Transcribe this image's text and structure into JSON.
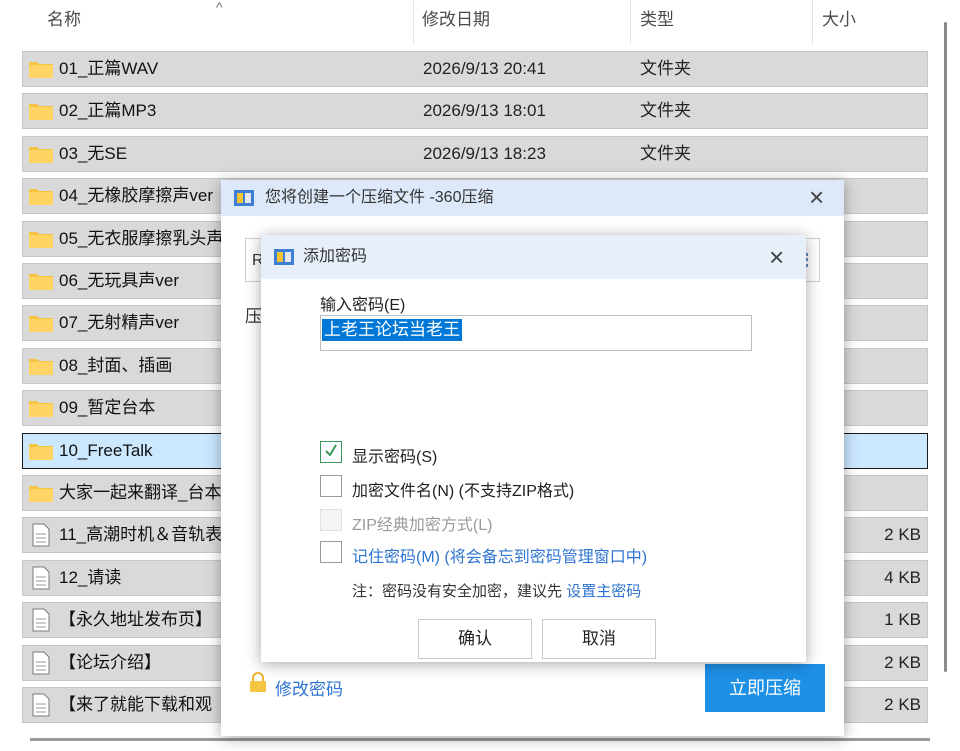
{
  "explorer": {
    "columns": {
      "name": "名称",
      "date": "修改日期",
      "type": "类型",
      "size": "大小"
    },
    "rows": [
      {
        "name": "01_正篇WAV",
        "date": "2026/9/13 20:41",
        "type": "文件夹",
        "size": "",
        "kind": "folder"
      },
      {
        "name": "02_正篇MP3",
        "date": "2026/9/13 18:01",
        "type": "文件夹",
        "size": "",
        "kind": "folder"
      },
      {
        "name": "03_无SE",
        "date": "2026/9/13 18:23",
        "type": "文件夹",
        "size": "",
        "kind": "folder"
      },
      {
        "name": "04_无橡胶摩擦声ver",
        "date": "",
        "type": "",
        "size": "",
        "kind": "folder"
      },
      {
        "name": "05_无衣服摩擦乳头声",
        "date": "",
        "type": "",
        "size": "",
        "kind": "folder"
      },
      {
        "name": "06_无玩具声ver",
        "date": "",
        "type": "",
        "size": "",
        "kind": "folder"
      },
      {
        "name": "07_无射精声ver",
        "date": "",
        "type": "",
        "size": "",
        "kind": "folder"
      },
      {
        "name": "08_封面、插画",
        "date": "",
        "type": "",
        "size": "",
        "kind": "folder"
      },
      {
        "name": "09_暂定台本",
        "date": "",
        "type": "",
        "size": "",
        "kind": "folder"
      },
      {
        "name": "10_FreeTalk",
        "date": "",
        "type": "",
        "size": "",
        "kind": "folder",
        "selected": true
      },
      {
        "name": "大家一起来翻译_台本",
        "date": "",
        "type": "",
        "size": "",
        "kind": "folder"
      },
      {
        "name": "11_高潮时机＆音轨表",
        "date": "",
        "type": "",
        "size": "2 KB",
        "kind": "file"
      },
      {
        "name": "12_请读",
        "date": "",
        "type": "",
        "size": "4 KB",
        "kind": "file"
      },
      {
        "name": "【永久地址发布页】",
        "date": "",
        "type": "",
        "size": "1 KB",
        "kind": "file"
      },
      {
        "name": "【论坛介绍】",
        "date": "",
        "type": "",
        "size": "2 KB",
        "kind": "file"
      },
      {
        "name": "【来了就能下载和观",
        "date": "",
        "type": "",
        "size": "2 KB",
        "kind": "file"
      }
    ]
  },
  "compress_dialog": {
    "title": "您将创建一个压缩文件 -360压缩",
    "path_prefix": "R",
    "label_prefix": "压",
    "modify_password": "修改密码",
    "compress_now": "立即压缩"
  },
  "password_dialog": {
    "title": "添加密码",
    "input_label": "输入密码(E)",
    "password_value": "上老王论坛当老王",
    "show_password": {
      "label": "显示密码(S)",
      "checked": true
    },
    "encrypt_filenames": {
      "label": "加密文件名(N) (不支持ZIP格式)",
      "checked": false
    },
    "zip_classic": {
      "label": "ZIP经典加密方式(L)",
      "checked": false,
      "disabled": true
    },
    "remember_password": {
      "label": "记住密码(M) (将会备忘到密码管理窗口中)",
      "checked": false
    },
    "note_text": "注：密码没有安全加密，建议先",
    "note_link": "设置主密码",
    "ok_button": "确认",
    "cancel_button": "取消"
  },
  "colors": {
    "accent": "#1e90e6",
    "link": "#2f74d0",
    "selection": "#0078d7",
    "folder": "#f5c542"
  }
}
